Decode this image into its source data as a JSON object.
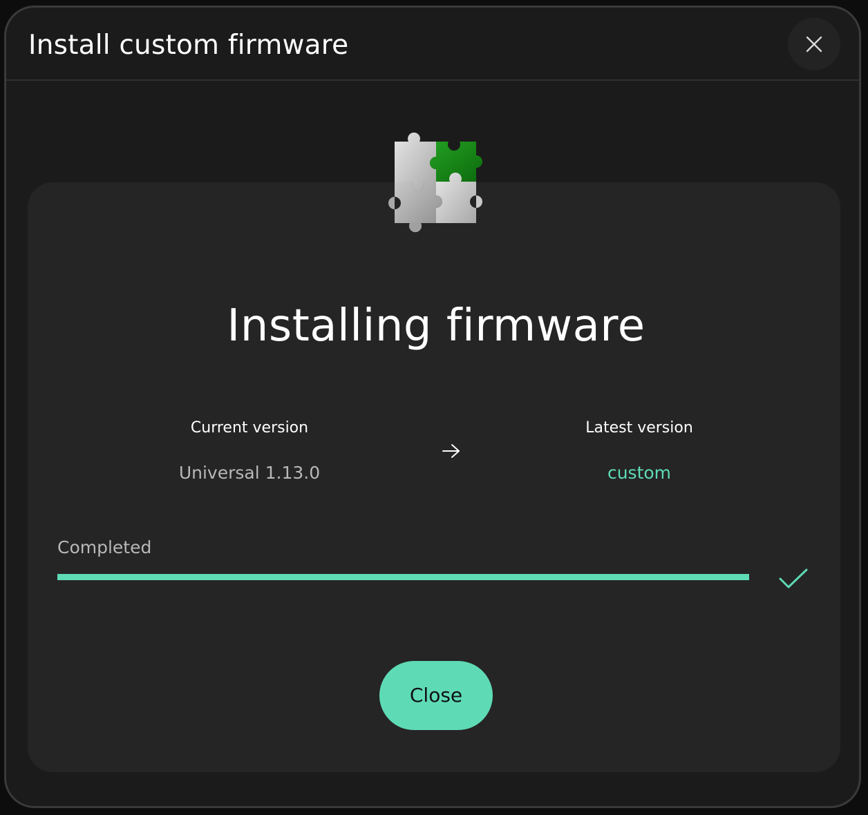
{
  "dialog": {
    "title": "Install custom firmware",
    "close_icon": "close-icon"
  },
  "illustration": {
    "icon": "puzzle-pieces-icon",
    "accent_color": "#1e8a1e"
  },
  "main": {
    "heading": "Installing firmware",
    "current_version": {
      "label": "Current version",
      "value": "Universal 1.13.0"
    },
    "arrow_icon": "arrow-right-icon",
    "latest_version": {
      "label": "Latest version",
      "value": "custom"
    }
  },
  "progress": {
    "label": "Completed",
    "fraction": 1.0,
    "status_icon": "checkmark-icon"
  },
  "actions": {
    "close_label": "Close"
  },
  "colors": {
    "accent": "#5edbb5",
    "background": "#1b1b1b",
    "panel": "#252525",
    "muted_text": "#b8b8b8"
  }
}
